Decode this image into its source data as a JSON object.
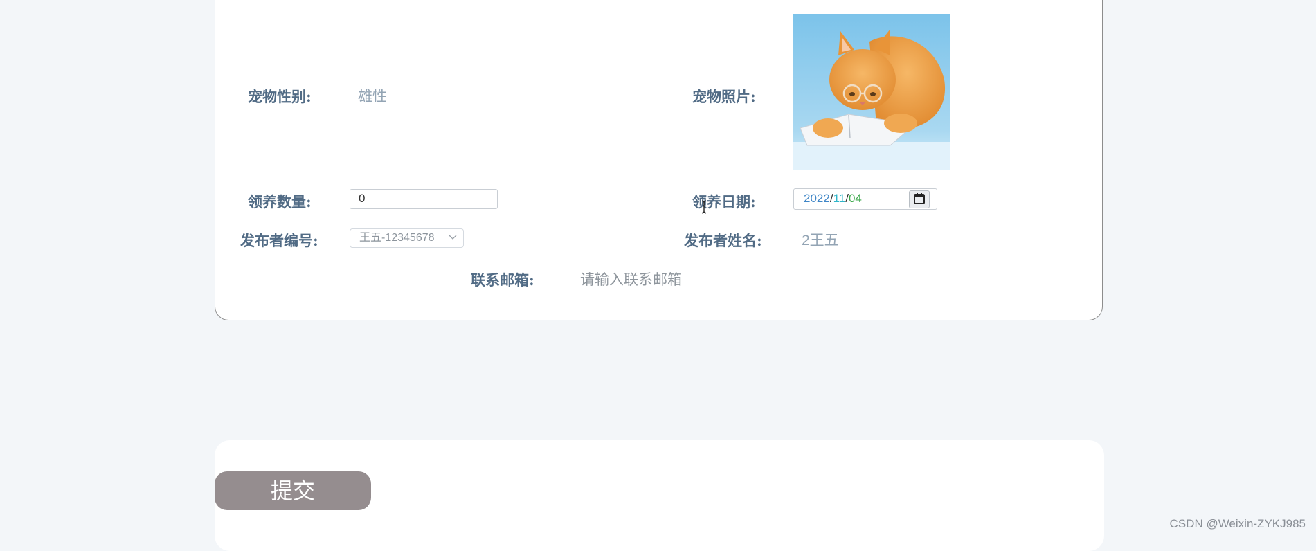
{
  "form": {
    "pet_gender": {
      "label": "宠物性别:",
      "value": "雄性"
    },
    "pet_photo": {
      "label": "宠物照片:"
    },
    "adopt_count": {
      "label": "领养数量:",
      "value": "0"
    },
    "adopt_date": {
      "label": "领养日期:",
      "year": "2022",
      "month": "11",
      "day": "04",
      "separator": "/"
    },
    "publisher_id": {
      "label": "发布者编号:",
      "selected": "王五-12345678"
    },
    "publisher_name": {
      "label": "发布者姓名:",
      "value": "2王五"
    },
    "contact_email": {
      "label": "联系邮箱:",
      "placeholder": "请输入联系邮箱"
    }
  },
  "submit": {
    "label": "提交"
  },
  "watermark": "CSDN @Weixin-ZYKJ985",
  "icons": {
    "calendar": "calendar-icon",
    "chevron": "chevron-down-icon"
  },
  "colors": {
    "label": "#516b85",
    "value": "#93a4b4",
    "submit_bg": "#958d8f",
    "page_bg": "#f3f6f9"
  }
}
